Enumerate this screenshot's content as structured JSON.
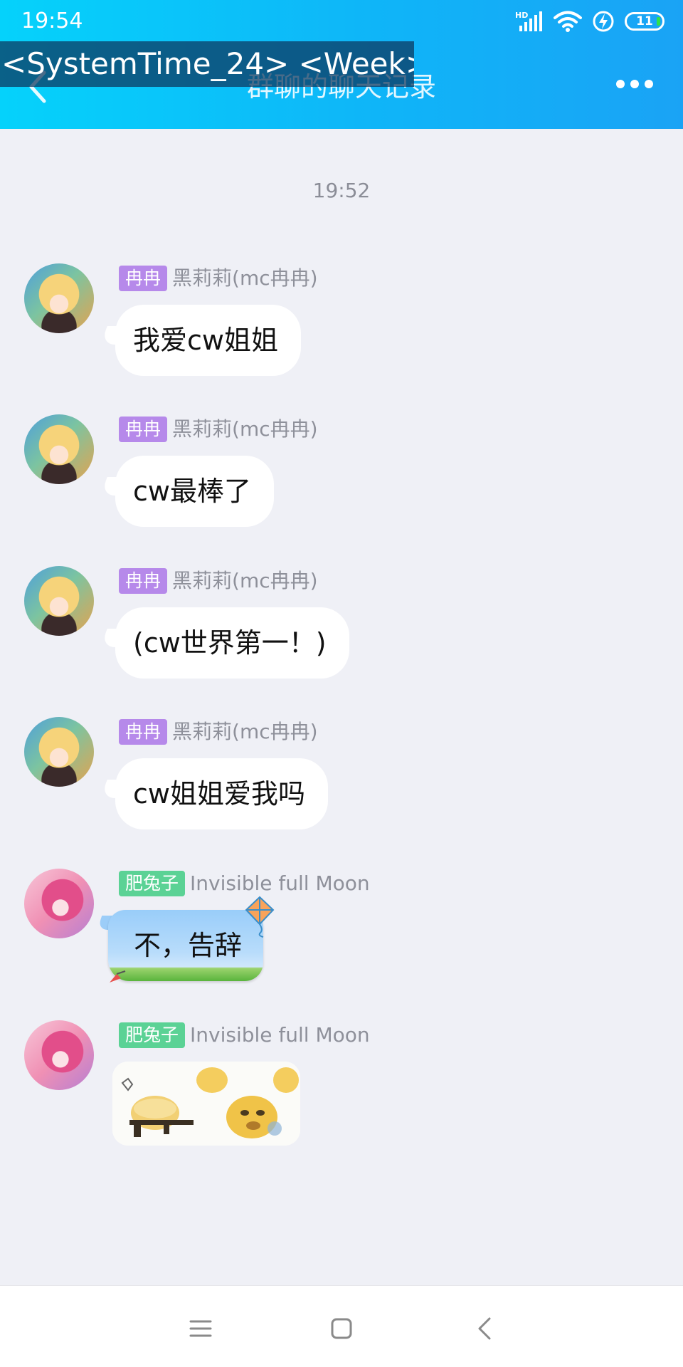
{
  "status_bar": {
    "time": "19:54",
    "network_label": "HD",
    "battery": "11"
  },
  "header": {
    "title": "群聊的聊天记录",
    "overlay_text": "<SystemTime_24> <Week>"
  },
  "chat": {
    "timestamp": "19:52",
    "messages": [
      {
        "badge": "冉冉",
        "name": "黑莉莉(mc冉冉)",
        "text": "我爱cw姐姐"
      },
      {
        "badge": "冉冉",
        "name": "黑莉莉(mc冉冉)",
        "text": "cw最棒了"
      },
      {
        "badge": "冉冉",
        "name": "黑莉莉(mc冉冉)",
        "text": "(cw世界第一！)"
      },
      {
        "badge": "冉冉",
        "name": "黑莉莉(mc冉冉)",
        "text": "cw姐姐爱我吗"
      },
      {
        "badge": "肥兔子",
        "name": "Invisible full Moon",
        "text": "不，告辞"
      },
      {
        "badge": "肥兔子",
        "name": "Invisible full Moon",
        "sticker": "meme-sticker"
      }
    ]
  },
  "icons": {
    "back": "back-arrow-icon",
    "more": "more-dots-icon",
    "signal": "signal-icon",
    "wifi": "wifi-icon",
    "charging": "charging-icon",
    "nav_menu": "menu-icon",
    "nav_home": "home-icon",
    "nav_back": "back-icon"
  },
  "colors": {
    "header_start": "#05d2fb",
    "header_end": "#1aa3f5",
    "badge_purple": "#b689ea",
    "badge_green": "#5bd295",
    "chat_background": "#eff0f6"
  }
}
